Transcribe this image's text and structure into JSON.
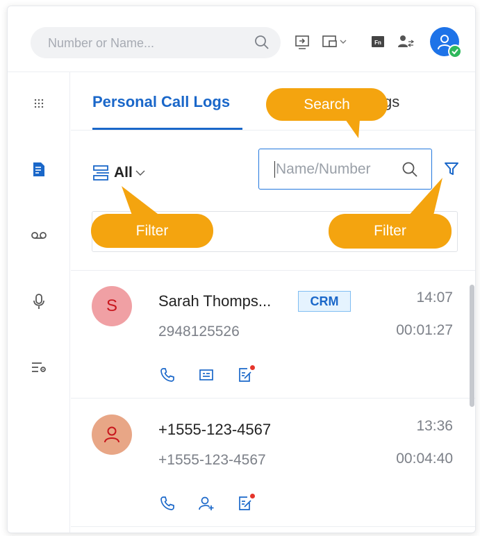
{
  "header": {
    "search_placeholder": "Number or Name...",
    "icons": [
      "search-icon",
      "transfer-screen-icon",
      "layout-switch-icon",
      "fn-key-icon",
      "contact-transfer-icon",
      "user-avatar-icon"
    ]
  },
  "sidebar": {
    "items": [
      "dialpad-icon",
      "call-logs-icon",
      "voicemail-icon",
      "recordings-icon",
      "settings-list-icon"
    ]
  },
  "tabs": {
    "active_label": "Personal Call Logs",
    "other_label_visible": "gs"
  },
  "filter": {
    "all_label": "All",
    "search_placeholder": "Name/Number"
  },
  "callouts": {
    "search": "Search",
    "filter_left": "Filter",
    "filter_right": "Filter"
  },
  "calls": [
    {
      "initial": "S",
      "name": "Sarah Thomps...",
      "badge": "CRM",
      "number": "2948125526",
      "time": "14:07",
      "duration": "00:01:27"
    },
    {
      "initial": "",
      "name": "+1555-123-4567",
      "badge": "",
      "number": "+1555-123-4567",
      "time": "13:36",
      "duration": "00:04:40"
    }
  ],
  "colors": {
    "accent": "#1a67c9",
    "callout": "#f4a40f",
    "avatar_s_bg": "#f0a0a4",
    "avatar_unknown_bg": "#e8a686"
  }
}
